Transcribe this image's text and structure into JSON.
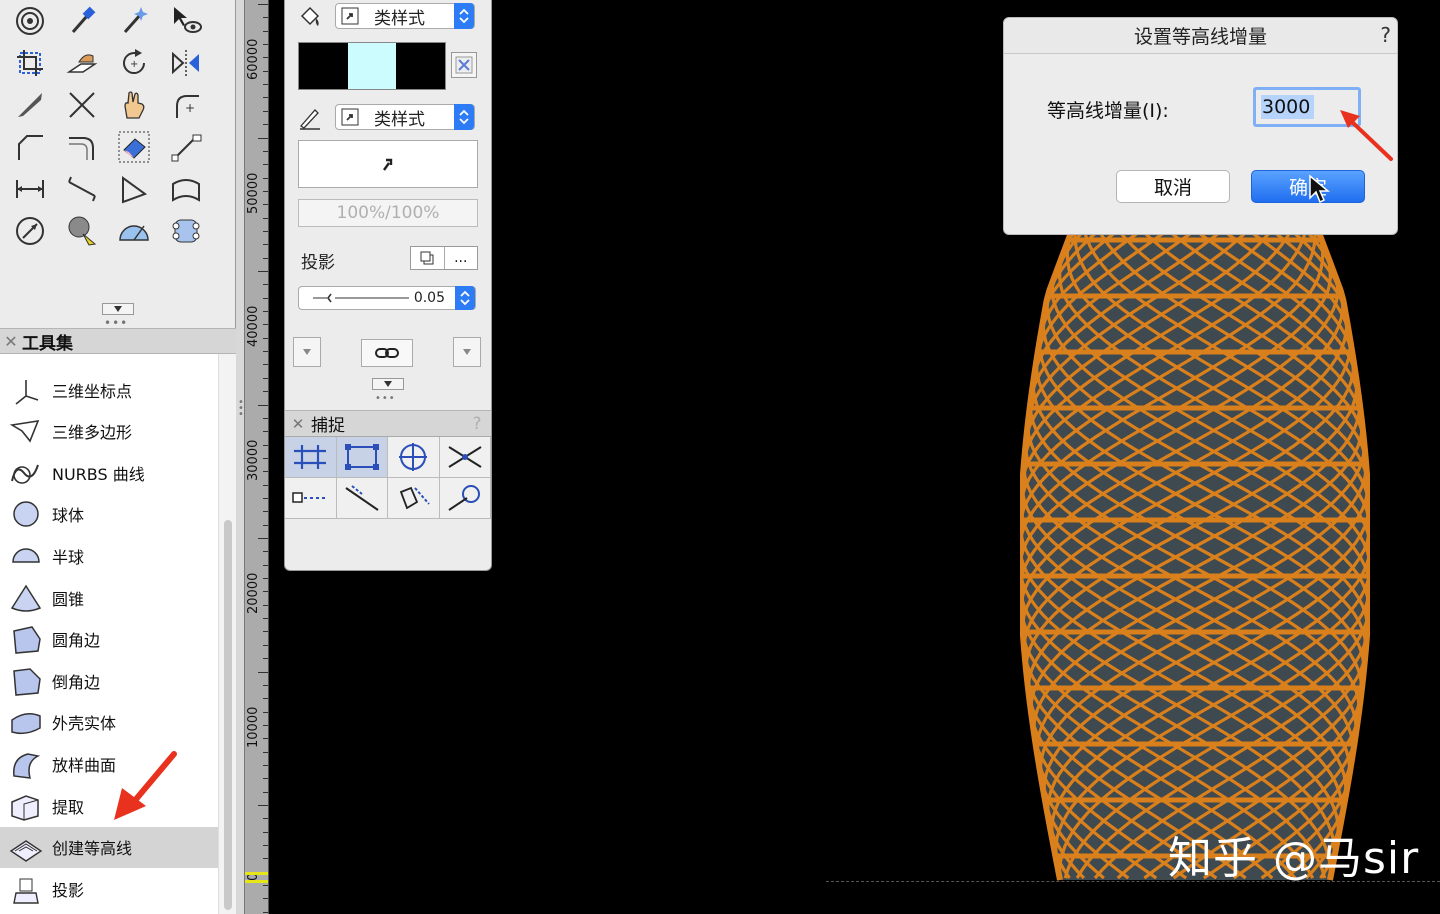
{
  "toolset": {
    "title": "工具集",
    "items": [
      {
        "label": "三维坐标点",
        "icon": "3d-locus-icon"
      },
      {
        "label": "三维多边形",
        "icon": "3d-polygon-icon"
      },
      {
        "label": "NURBS 曲线",
        "icon": "nurbs-curve-icon"
      },
      {
        "label": "球体",
        "icon": "sphere-icon"
      },
      {
        "label": "半球",
        "icon": "hemisphere-icon"
      },
      {
        "label": "圆锥",
        "icon": "cone-icon"
      },
      {
        "label": "圆角边",
        "icon": "fillet-edge-icon"
      },
      {
        "label": "倒角边",
        "icon": "chamfer-edge-icon"
      },
      {
        "label": "外壳实体",
        "icon": "shell-solid-icon"
      },
      {
        "label": "放样曲面",
        "icon": "loft-surface-icon"
      },
      {
        "label": "提取",
        "icon": "extract-icon"
      },
      {
        "label": "创建等高线",
        "icon": "create-contours-icon",
        "selected": true
      },
      {
        "label": "投影",
        "icon": "project-icon"
      }
    ]
  },
  "ruler": {
    "labels": [
      "60000",
      "50000",
      "40000",
      "30000",
      "20000",
      "10000",
      "0"
    ]
  },
  "attributes": {
    "fill_style_label": "类样式",
    "pen_style_label": "类样式",
    "opacity": "100%/100%",
    "shadow_label": "投影",
    "shadow_more": "...",
    "line_thickness": "0.05",
    "fill_colors": [
      "#000000",
      "#ccfcfd",
      "#000000"
    ]
  },
  "snapping": {
    "title": "捕捉",
    "help": "?"
  },
  "dialog": {
    "title": "设置等高线增量",
    "help": "?",
    "field_label": "等高线增量(I):",
    "field_value": "3000",
    "cancel_label": "取消",
    "ok_label": "确定"
  },
  "watermark": "知乎 @马sir",
  "colors": {
    "tower": "#d9801c",
    "accent_blue": "#2d7cf6",
    "annotation_red": "#e8321e"
  }
}
